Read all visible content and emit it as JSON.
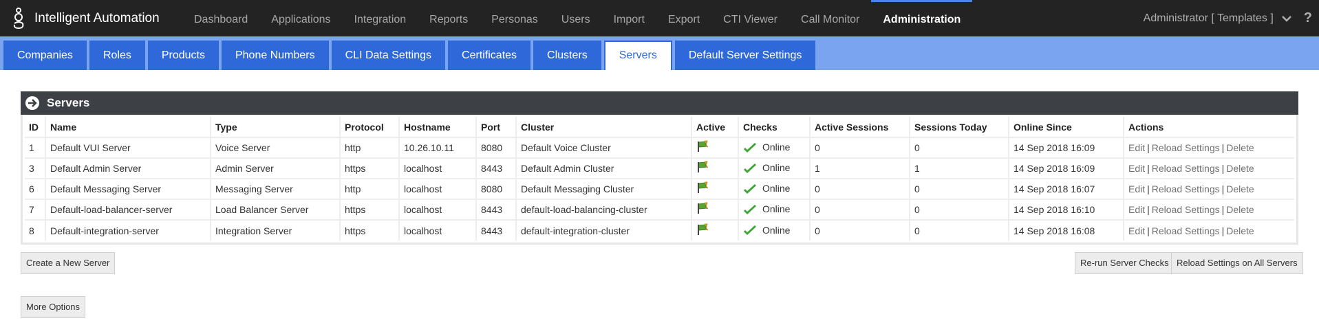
{
  "app": {
    "title": "Intelligent Automation"
  },
  "nav": [
    {
      "label": "Dashboard",
      "active": false
    },
    {
      "label": "Applications",
      "active": false
    },
    {
      "label": "Integration",
      "active": false
    },
    {
      "label": "Reports",
      "active": false
    },
    {
      "label": "Personas",
      "active": false
    },
    {
      "label": "Users",
      "active": false
    },
    {
      "label": "Import",
      "active": false
    },
    {
      "label": "Export",
      "active": false
    },
    {
      "label": "CTI Viewer",
      "active": false
    },
    {
      "label": "Call Monitor",
      "active": false
    },
    {
      "label": "Administration",
      "active": true
    }
  ],
  "user": {
    "label": "Administrator [ Templates ]",
    "help": "?"
  },
  "subtabs": [
    {
      "label": "Companies",
      "active": false
    },
    {
      "label": "Roles",
      "active": false
    },
    {
      "label": "Products",
      "active": false
    },
    {
      "label": "Phone Numbers",
      "active": false
    },
    {
      "label": "CLI Data Settings",
      "active": false
    },
    {
      "label": "Certificates",
      "active": false
    },
    {
      "label": "Clusters",
      "active": false
    },
    {
      "label": "Servers",
      "active": true
    },
    {
      "label": "Default Server Settings",
      "active": false
    }
  ],
  "panel": {
    "title": "Servers"
  },
  "table": {
    "columns": [
      "ID",
      "Name",
      "Type",
      "Protocol",
      "Hostname",
      "Port",
      "Cluster",
      "Active",
      "Checks",
      "Active Sessions",
      "Sessions Today",
      "Online Since",
      "Actions"
    ],
    "rows": [
      {
        "id": "1",
        "name": "Default VUI Server",
        "type": "Voice Server",
        "protocol": "http",
        "hostname": "10.26.10.11",
        "port": "8080",
        "cluster": "Default Voice Cluster",
        "checks": "Online",
        "active_sessions": "0",
        "sessions_today": "0",
        "online_since": "14 Sep 2018 16:09"
      },
      {
        "id": "3",
        "name": "Default Admin Server",
        "type": "Admin Server",
        "protocol": "https",
        "hostname": "localhost",
        "port": "8443",
        "cluster": "Default Admin Cluster",
        "checks": "Online",
        "active_sessions": "1",
        "sessions_today": "1",
        "online_since": "14 Sep 2018 16:09"
      },
      {
        "id": "6",
        "name": "Default Messaging Server",
        "type": "Messaging Server",
        "protocol": "http",
        "hostname": "localhost",
        "port": "8080",
        "cluster": "Default Messaging Cluster",
        "checks": "Online",
        "active_sessions": "0",
        "sessions_today": "0",
        "online_since": "14 Sep 2018 16:07"
      },
      {
        "id": "7",
        "name": "Default-load-balancer-server",
        "type": "Load Balancer Server",
        "protocol": "https",
        "hostname": "localhost",
        "port": "8443",
        "cluster": "default-load-balancing-cluster",
        "checks": "Online",
        "active_sessions": "0",
        "sessions_today": "0",
        "online_since": "14 Sep 2018 16:10"
      },
      {
        "id": "8",
        "name": "Default-integration-server",
        "type": "Integration Server",
        "protocol": "https",
        "hostname": "localhost",
        "port": "8443",
        "cluster": "default-integration-cluster",
        "checks": "Online",
        "active_sessions": "0",
        "sessions_today": "0",
        "online_since": "14 Sep 2018 16:08"
      }
    ],
    "actions": [
      "Edit",
      "Reload Settings",
      "Delete"
    ]
  },
  "buttons": {
    "create": "Create a New Server",
    "rerun": "Re-run Server Checks",
    "reload_all": "Reload Settings on All Servers",
    "more": "More Options"
  },
  "icons": {
    "logo": "genesys-logo-icon",
    "chevron": "chevron-down-icon",
    "panel": "arrow-circle-right-icon",
    "active": "green-flag-icon",
    "check": "green-check-icon"
  },
  "colors": {
    "topbar": "#232323",
    "nav_accent": "#4a86e8",
    "subbar": "#7aa4f0",
    "subtab": "#2f69d9",
    "panel_header": "#3d4146",
    "flag": "#5aa532",
    "check": "#3fa535"
  }
}
